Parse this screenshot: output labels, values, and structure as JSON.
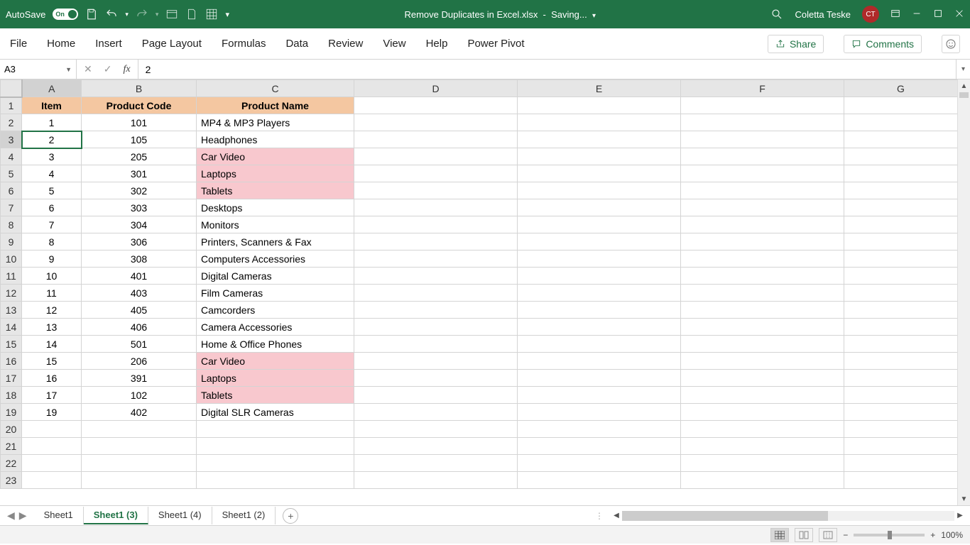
{
  "titlebar": {
    "autosave": "AutoSave",
    "autosave_state": "On",
    "filename": "Remove Duplicates in Excel.xlsx",
    "status": "Saving...",
    "user": "Coletta Teske",
    "initials": "CT"
  },
  "ribbon": {
    "tabs": [
      "File",
      "Home",
      "Insert",
      "Page Layout",
      "Formulas",
      "Data",
      "Review",
      "View",
      "Help",
      "Power Pivot"
    ],
    "share": "Share",
    "comments": "Comments"
  },
  "formulabar": {
    "namebox": "A3",
    "fx": "fx",
    "value": "2"
  },
  "columns": [
    "A",
    "B",
    "C",
    "D",
    "E",
    "F",
    "G"
  ],
  "headers": {
    "A": "Item",
    "B": "Product Code",
    "C": "Product Name"
  },
  "rows": [
    {
      "n": 2,
      "A": "1",
      "B": "101",
      "C": "MP4 & MP3 Players",
      "hl": false
    },
    {
      "n": 3,
      "A": "2",
      "B": "105",
      "C": "Headphones",
      "hl": false
    },
    {
      "n": 4,
      "A": "3",
      "B": "205",
      "C": "Car Video",
      "hl": true
    },
    {
      "n": 5,
      "A": "4",
      "B": "301",
      "C": "Laptops",
      "hl": true
    },
    {
      "n": 6,
      "A": "5",
      "B": "302",
      "C": "Tablets",
      "hl": true
    },
    {
      "n": 7,
      "A": "6",
      "B": "303",
      "C": "Desktops",
      "hl": false
    },
    {
      "n": 8,
      "A": "7",
      "B": "304",
      "C": "Monitors",
      "hl": false
    },
    {
      "n": 9,
      "A": "8",
      "B": "306",
      "C": "Printers, Scanners & Fax",
      "hl": false
    },
    {
      "n": 10,
      "A": "9",
      "B": "308",
      "C": "Computers Accessories",
      "hl": false
    },
    {
      "n": 11,
      "A": "10",
      "B": "401",
      "C": "Digital Cameras",
      "hl": false
    },
    {
      "n": 12,
      "A": "11",
      "B": "403",
      "C": "Film Cameras",
      "hl": false
    },
    {
      "n": 13,
      "A": "12",
      "B": "405",
      "C": "Camcorders",
      "hl": false
    },
    {
      "n": 14,
      "A": "13",
      "B": "406",
      "C": "Camera Accessories",
      "hl": false
    },
    {
      "n": 15,
      "A": "14",
      "B": "501",
      "C": "Home & Office Phones",
      "hl": false
    },
    {
      "n": 16,
      "A": "15",
      "B": "206",
      "C": "Car Video",
      "hl": true
    },
    {
      "n": 17,
      "A": "16",
      "B": "391",
      "C": "Laptops",
      "hl": true
    },
    {
      "n": 18,
      "A": "17",
      "B": "102",
      "C": "Tablets",
      "hl": true
    },
    {
      "n": 19,
      "A": "19",
      "B": "402",
      "C": "Digital SLR Cameras",
      "hl": false
    }
  ],
  "empty_rows": [
    20,
    21,
    22,
    23
  ],
  "selected_cell": "A3",
  "sheets": {
    "tabs": [
      "Sheet1",
      "Sheet1 (3)",
      "Sheet1 (4)",
      "Sheet1 (2)"
    ],
    "active": 1
  },
  "statusbar": {
    "zoom": "100%"
  }
}
